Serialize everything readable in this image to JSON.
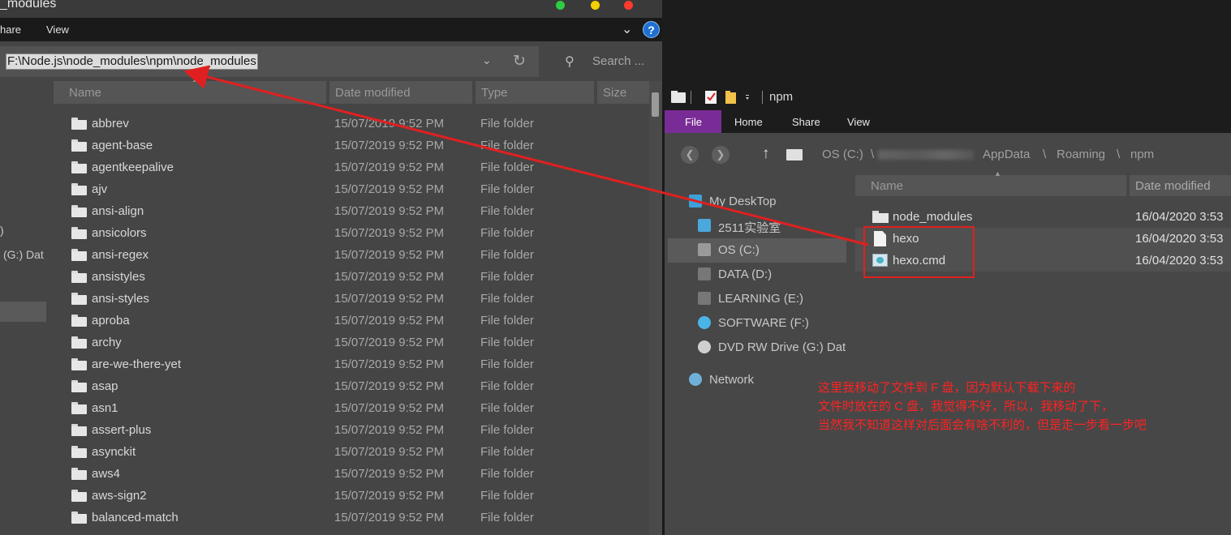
{
  "left_window": {
    "title": "_modules",
    "ribbon_tabs": [
      "hare",
      "View"
    ],
    "help_label": "?",
    "address": "F:\\Node.js\\node_modules\\npm\\node_modules",
    "search_placeholder": "Search ...",
    "nav_items": [
      ")",
      "(G:) Dat"
    ],
    "columns": [
      "Name",
      "Date modified",
      "Type",
      "Size"
    ],
    "rows": [
      {
        "name": "abbrev",
        "date": "15/07/2019 9:52 PM",
        "type": "File folder"
      },
      {
        "name": "agent-base",
        "date": "15/07/2019 9:52 PM",
        "type": "File folder"
      },
      {
        "name": "agentkeepalive",
        "date": "15/07/2019 9:52 PM",
        "type": "File folder"
      },
      {
        "name": "ajv",
        "date": "15/07/2019 9:52 PM",
        "type": "File folder"
      },
      {
        "name": "ansi-align",
        "date": "15/07/2019 9:52 PM",
        "type": "File folder"
      },
      {
        "name": "ansicolors",
        "date": "15/07/2019 9:52 PM",
        "type": "File folder"
      },
      {
        "name": "ansi-regex",
        "date": "15/07/2019 9:52 PM",
        "type": "File folder"
      },
      {
        "name": "ansistyles",
        "date": "15/07/2019 9:52 PM",
        "type": "File folder"
      },
      {
        "name": "ansi-styles",
        "date": "15/07/2019 9:52 PM",
        "type": "File folder"
      },
      {
        "name": "aproba",
        "date": "15/07/2019 9:52 PM",
        "type": "File folder"
      },
      {
        "name": "archy",
        "date": "15/07/2019 9:52 PM",
        "type": "File folder"
      },
      {
        "name": "are-we-there-yet",
        "date": "15/07/2019 9:52 PM",
        "type": "File folder"
      },
      {
        "name": "asap",
        "date": "15/07/2019 9:52 PM",
        "type": "File folder"
      },
      {
        "name": "asn1",
        "date": "15/07/2019 9:52 PM",
        "type": "File folder"
      },
      {
        "name": "assert-plus",
        "date": "15/07/2019 9:52 PM",
        "type": "File folder"
      },
      {
        "name": "asynckit",
        "date": "15/07/2019 9:52 PM",
        "type": "File folder"
      },
      {
        "name": "aws4",
        "date": "15/07/2019 9:52 PM",
        "type": "File folder"
      },
      {
        "name": "aws-sign2",
        "date": "15/07/2019 9:52 PM",
        "type": "File folder"
      },
      {
        "name": "balanced-match",
        "date": "15/07/2019 9:52 PM",
        "type": "File folder"
      }
    ]
  },
  "right_window": {
    "title": "npm",
    "ribbon_tabs": [
      "File",
      "Home",
      "Share",
      "View"
    ],
    "breadcrumb": [
      "OS (C:)",
      "\\",
      "AppData",
      "\\",
      "Roaming",
      "\\",
      "npm"
    ],
    "columns": [
      "Name",
      "Date modified"
    ],
    "nav_items": [
      {
        "label": "My DeskTop",
        "icon": "desktop-icon"
      },
      {
        "label": "2511实验室",
        "icon": "folder-icon"
      },
      {
        "label": "OS (C:)",
        "icon": "windows-drive-icon"
      },
      {
        "label": "DATA (D:)",
        "icon": "drive-icon"
      },
      {
        "label": "LEARNING (E:)",
        "icon": "drive-icon"
      },
      {
        "label": "SOFTWARE (F:)",
        "icon": "software-drive-icon"
      },
      {
        "label": "DVD RW Drive (G:) Dat",
        "icon": "dvd-icon"
      },
      {
        "label": "Network",
        "icon": "network-icon"
      }
    ],
    "rows": [
      {
        "name": "node_modules",
        "date": "16/04/2020 3:53",
        "icon": "folder-icon"
      },
      {
        "name": "hexo",
        "date": "16/04/2020 3:53",
        "icon": "file-icon"
      },
      {
        "name": "hexo.cmd",
        "date": "16/04/2020 3:53",
        "icon": "cmd-icon"
      }
    ]
  },
  "annotation": {
    "lines": [
      "这里我移动了文件到 F 盘，因为默认下载下来的",
      "文件时放在的 C 盘，我觉得不好，所以，我移动了下，",
      "当然我不知道这样对后面会有啥不利的，但是走一步看一步吧"
    ],
    "color": "#ff2222"
  },
  "colors": {
    "accent_file_tab": "#7a2c96",
    "help_blue": "#1f6fd1",
    "traffic_green": "#2ecc40",
    "traffic_yellow": "#f5d000",
    "traffic_red": "#ff3b30"
  }
}
